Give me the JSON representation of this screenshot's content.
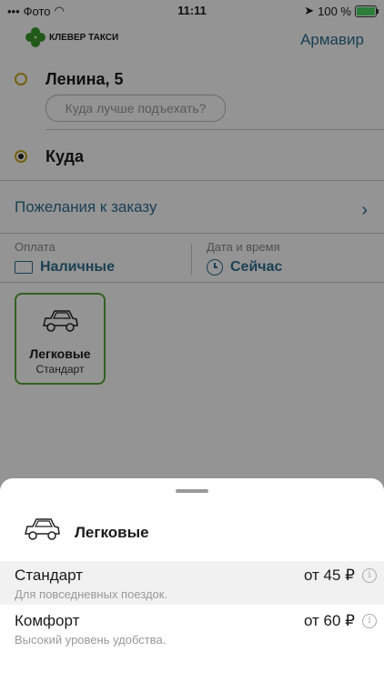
{
  "status_bar": {
    "carrier": "Фото",
    "time": "11:11",
    "battery": "100 %"
  },
  "header": {
    "logo_text": "КЛЕВЕР ТАКСИ",
    "city": "Армавир"
  },
  "route": {
    "from_address": "Ленина, 5",
    "from_hint": "Куда лучше подъехать?",
    "to_placeholder": "Куда"
  },
  "wishes_label": "Пожелания к заказу",
  "payment": {
    "label": "Оплата",
    "value": "Наличные"
  },
  "datetime": {
    "label": "Дата и время",
    "value": "Сейчас"
  },
  "tariff_card": {
    "title": "Легковые",
    "subtitle": "Стандарт"
  },
  "sheet": {
    "title": "Легковые",
    "options": [
      {
        "name": "Стандарт",
        "description": "Для повседневных поездок.",
        "price": "от 45 ₽",
        "highlighted": true
      },
      {
        "name": "Комфорт",
        "description": "Высокий уровень удобства.",
        "price": "от 60 ₽",
        "highlighted": false
      }
    ]
  },
  "colors": {
    "accent": "#2f6f8f",
    "brand_green": "#5aa63a",
    "dot_yellow": "#c9a820"
  }
}
